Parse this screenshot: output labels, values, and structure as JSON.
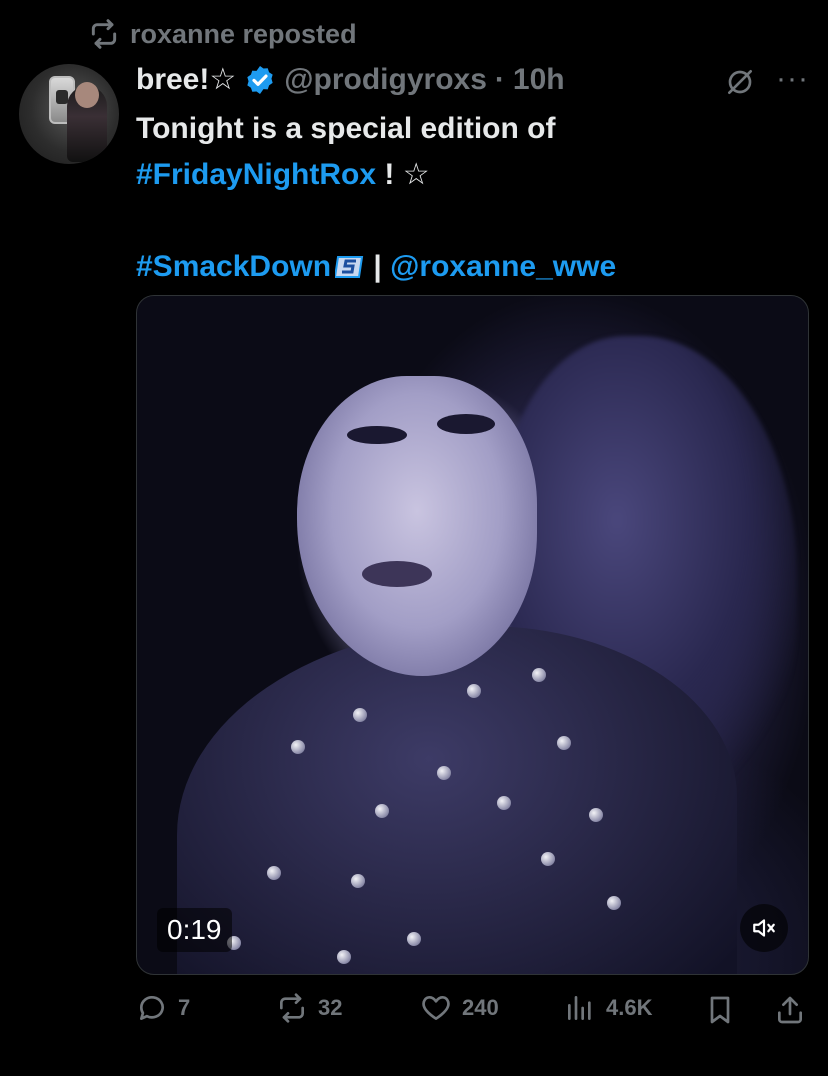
{
  "repost": {
    "text": "roxanne reposted"
  },
  "tweet": {
    "author_name": "bree!☆",
    "handle": "@prodigyroxs",
    "separator": "·",
    "time": "10h",
    "text_line1": "Tonight is a special edition of",
    "hashtag1": "#FridayNightRox",
    "after_hashtag1": " ! ☆",
    "hashtag2": "#SmackDown",
    "pipe": " | ",
    "mention": "@roxanne_wwe"
  },
  "media": {
    "duration": "0:19"
  },
  "actions": {
    "replies": "7",
    "reposts": "32",
    "likes": "240",
    "views": "4.6K"
  },
  "colors": {
    "accent": "#1d9bf0",
    "muted": "#71767b",
    "text": "#e7e9ea",
    "background": "#000000"
  },
  "icons": [
    "repost-icon",
    "verified-badge-icon",
    "grok-icon",
    "more-icon",
    "smackdown-logo-icon",
    "mute-icon",
    "reply-icon",
    "like-icon",
    "views-icon",
    "bookmark-icon",
    "share-icon"
  ]
}
